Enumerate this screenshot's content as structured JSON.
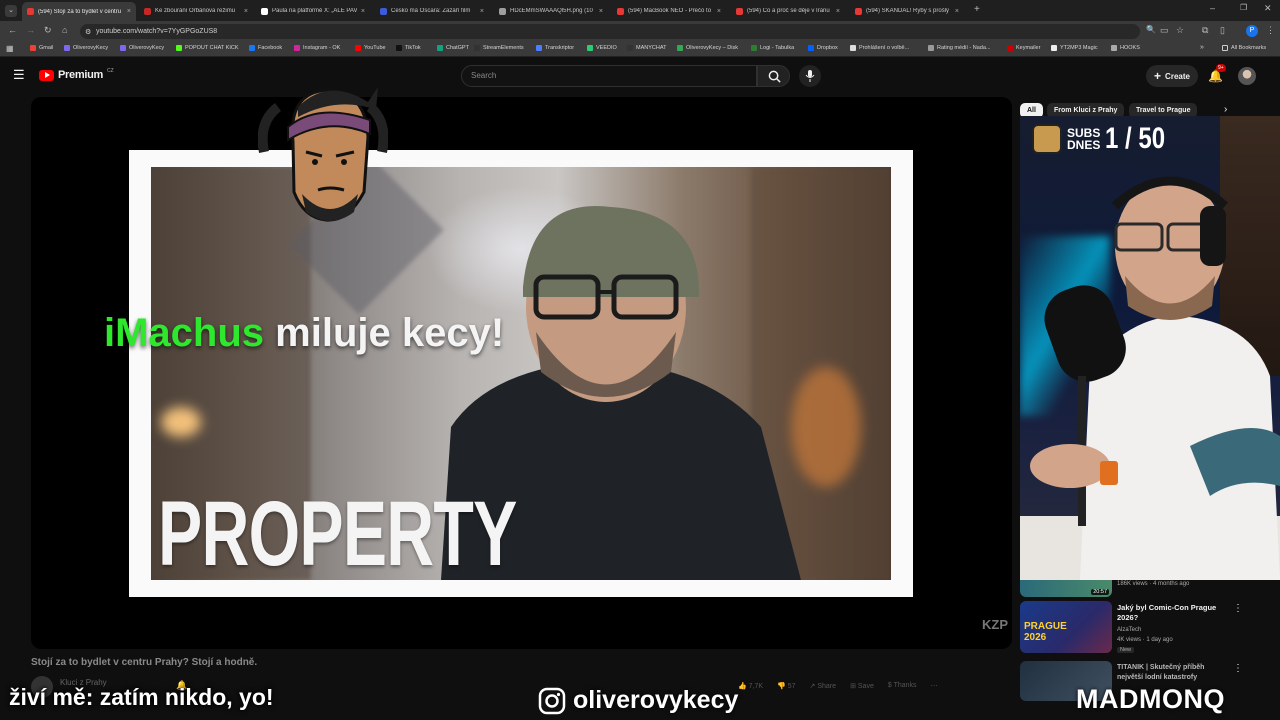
{
  "browser": {
    "tabs": [
      {
        "title": "(594) Stojí za to bydlet v centru",
        "active": true,
        "color": "#e53935"
      },
      {
        "title": "Ke zbourání Orbánova režimu",
        "color": "#c62828"
      },
      {
        "title": "Paula na platformě X: „ALE PAV",
        "color": "#ffffff"
      },
      {
        "title": "Česko má Oscara: Zazáří film",
        "color": "#3b5bdb"
      },
      {
        "title": "HDcEMmSWAAAQl5H.png (10",
        "color": "#9e9e9e"
      },
      {
        "title": "(594) MacBook NEO - Prečo to",
        "color": "#e53935"
      },
      {
        "title": "(594) Co a proč se děje v Íránu",
        "color": "#e53935"
      },
      {
        "title": "(594) SKANDÁL! Ryby s prošlý",
        "color": "#e53935"
      }
    ],
    "url": "youtube.com/watch?v=7YyGPGoZUS8",
    "bookmarks": [
      "Gmail",
      "OliverovyKecy",
      "OliverovyKecy",
      "POPOUT CHAT KICK",
      "Facebook",
      "Instagram - OK",
      "YouTube",
      "TikTok",
      "ChatGPT",
      "StreamElements",
      "Transkriptor",
      "VEEDIO",
      "MANYCHAT",
      "OliverovyKecy – Disk",
      "Logi - Tabulka",
      "Dropbox",
      "Prohlášení o volbě...",
      "Rating médií - Nada...",
      "Keymailer",
      "YT2MP3 Magic",
      "HOOKS"
    ],
    "all_bookmarks": "All Bookmarks"
  },
  "youtube": {
    "logo": "Premium",
    "region": "CZ",
    "search_placeholder": "Search",
    "create_label": "Create",
    "notif_count": "9+",
    "chips": [
      "All",
      "From Kluci z Prahy",
      "Travel to Prague"
    ],
    "video_title": "Stojí za to bydlet v centru Prahy? Stojí a hodně.",
    "channel": "Kluci z Prahy",
    "likes": "7,7K",
    "dislikes": "57",
    "share": "Share",
    "save": "Save",
    "thanks": "Thanks",
    "thumb_text": "PROPERTY",
    "watermark": "KZP",
    "recommended": [
      {
        "meta": "186K views · 4 months ago",
        "duration": "20:57"
      },
      {
        "title": "Jaký byl Comic-Con Prague 2026?",
        "channel": "AlzaTech",
        "meta": "4K views · 1 day ago",
        "badge": "New",
        "thumb_text": "PRAGUE 2026"
      },
      {
        "title": "TITANIK | Skutečný příběh největší lodní katastrofy",
        "channel": ""
      }
    ]
  },
  "stream_overlay": {
    "chat_name": "iMachus",
    "chat_rest": "miluje kecy!",
    "subs_label_1": "SUBS",
    "subs_label_2": "DNES",
    "subs_count": "1 / 50",
    "bottom_left": "živí mě: zatím nikdo, yo!",
    "instagram": "oliverovykecy",
    "bottom_right": "MADMONQ"
  },
  "colors": {
    "yt_red": "#ff0000",
    "green": "#2ee82e",
    "bg": "#0f0f0f"
  }
}
